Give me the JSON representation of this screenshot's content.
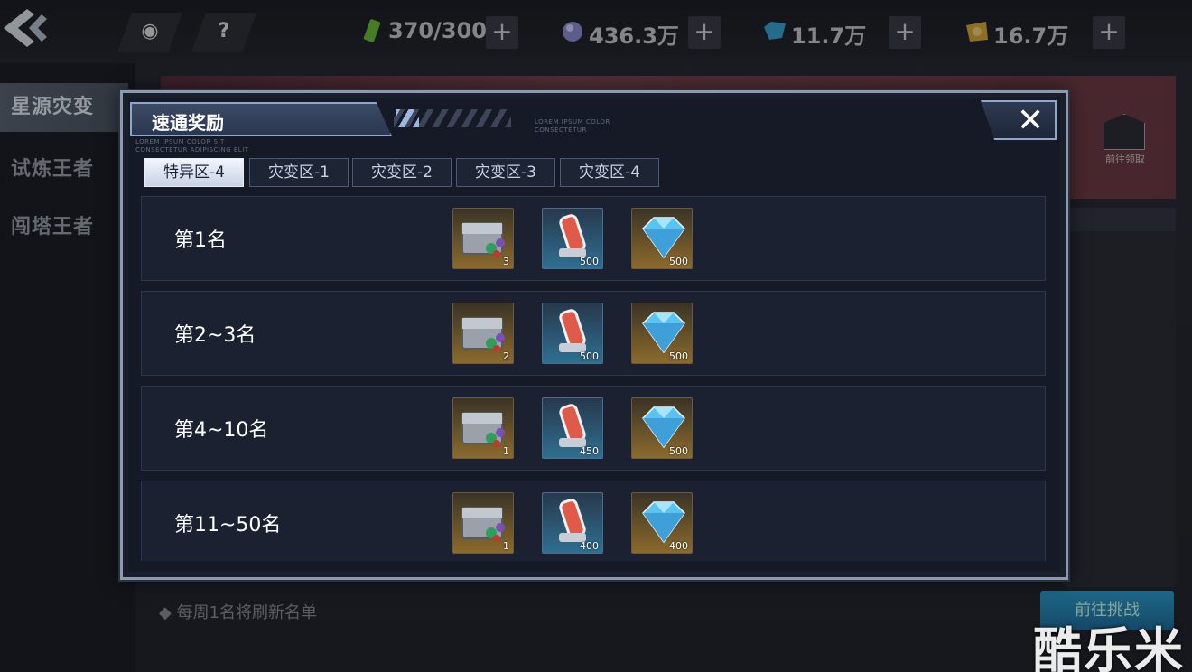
{
  "topbar": {
    "back_icon": "back-chevron-icon",
    "buttons": [
      {
        "name": "target-icon",
        "glyph": "◉"
      },
      {
        "name": "help-icon",
        "glyph": "?"
      }
    ],
    "resources": [
      {
        "name": "stamina",
        "icon": "battery-icon",
        "value": "370/300",
        "plus": "+"
      },
      {
        "name": "crystal-orb",
        "icon": "orb-icon",
        "value": "436.3万",
        "plus": "+"
      },
      {
        "name": "blue-gem",
        "icon": "blue-gem-icon",
        "value": "11.7万",
        "plus": "+"
      },
      {
        "name": "gold-coin",
        "icon": "gold-coin-icon",
        "value": "16.7万",
        "plus": "+"
      }
    ]
  },
  "background": {
    "left_menu": [
      "星源灾变",
      "试炼王者",
      "闯塔王者"
    ],
    "right_icon_label": "前往领取",
    "bottom_hint": "◆ 每周1名将刷新名单",
    "bottom_button": "前往挑战",
    "watermark": "酷乐米"
  },
  "modal": {
    "title": "速通奖励",
    "lorem_left": "LOREM IPSUM COLOR SIT\nCONSECTETUR ADIPISCING ELIT",
    "lorem_right": "LOREM IPSUM COLOR\nCONSECTETUR",
    "close_glyph": "✕",
    "tabs": [
      "特异区-4",
      "灾变区-1",
      "灾变区-2",
      "灾变区-3",
      "灾变区-4"
    ],
    "active_tab": 0,
    "rows": [
      {
        "rank": "第1名",
        "rewards": [
          {
            "icon": "treasure-chest-icon",
            "count": "3"
          },
          {
            "icon": "energy-capsule-icon",
            "count": "500"
          },
          {
            "icon": "diamond-icon",
            "count": "500"
          }
        ]
      },
      {
        "rank": "第2~3名",
        "rewards": [
          {
            "icon": "treasure-chest-icon",
            "count": "2"
          },
          {
            "icon": "energy-capsule-icon",
            "count": "500"
          },
          {
            "icon": "diamond-icon",
            "count": "500"
          }
        ]
      },
      {
        "rank": "第4~10名",
        "rewards": [
          {
            "icon": "treasure-chest-icon",
            "count": "1"
          },
          {
            "icon": "energy-capsule-icon",
            "count": "450"
          },
          {
            "icon": "diamond-icon",
            "count": "500"
          }
        ]
      },
      {
        "rank": "第11~50名",
        "rewards": [
          {
            "icon": "treasure-chest-icon",
            "count": "1"
          },
          {
            "icon": "energy-capsule-icon",
            "count": "400"
          },
          {
            "icon": "diamond-icon",
            "count": "400"
          }
        ]
      }
    ]
  }
}
